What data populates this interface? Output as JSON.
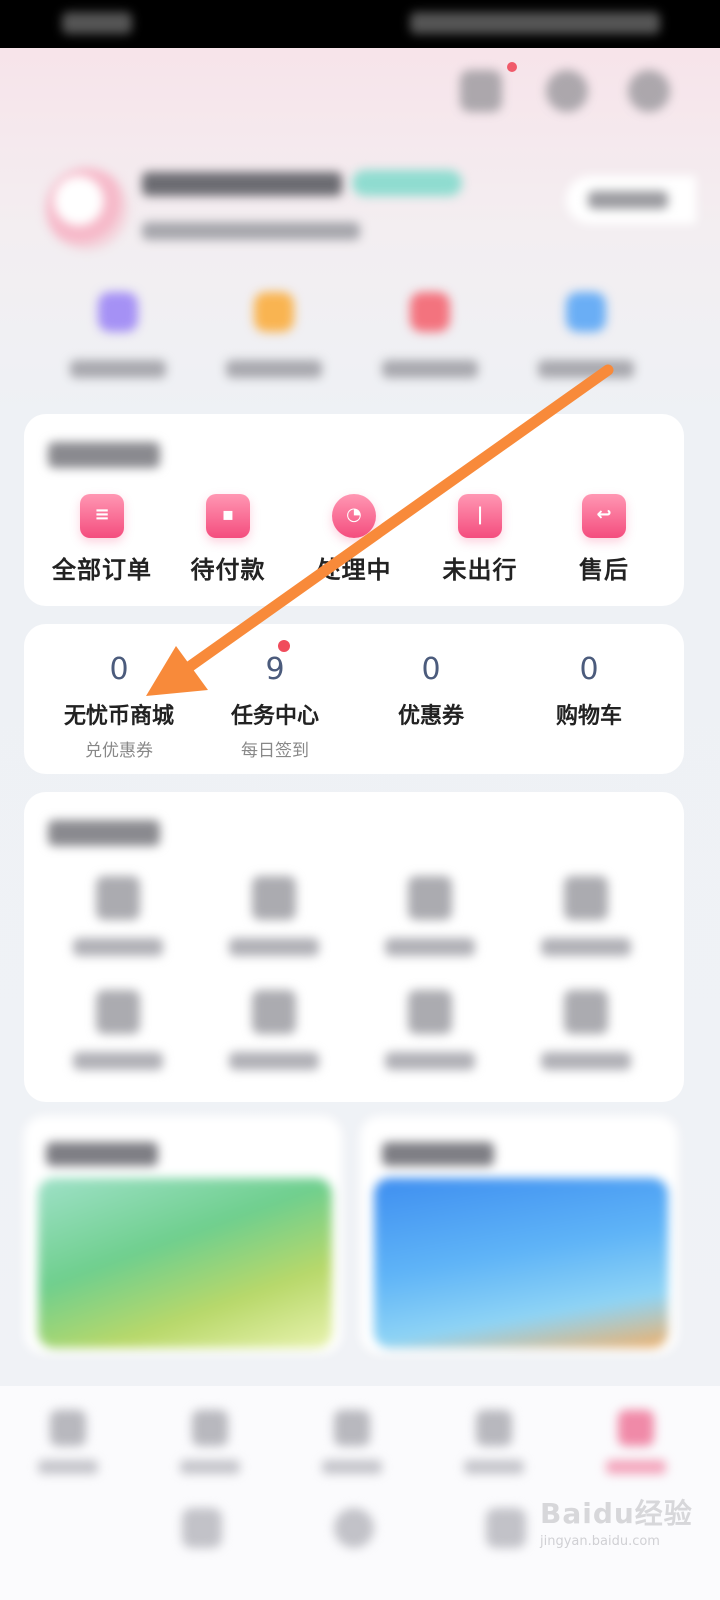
{
  "orders": {
    "items": [
      {
        "label": "全部订单",
        "icon": "order-list-icon"
      },
      {
        "label": "待付款",
        "icon": "wallet-icon"
      },
      {
        "label": "处理中",
        "icon": "clock-icon"
      },
      {
        "label": "未出行",
        "icon": "door-icon"
      },
      {
        "label": "售后",
        "icon": "return-icon"
      }
    ]
  },
  "stats": {
    "items": [
      {
        "value": "0",
        "label": "无忧币商城",
        "sub": "兑优惠券"
      },
      {
        "value": "9",
        "label": "任务中心",
        "sub": "每日签到"
      },
      {
        "value": "0",
        "label": "优惠券",
        "sub": ""
      },
      {
        "value": "0",
        "label": "购物车",
        "sub": ""
      }
    ]
  },
  "colors": {
    "accent": "#f44d7e",
    "stat_number": "#4b5b7c",
    "annotation_arrow": "#f88a3a",
    "badge_dot": "#f04c5c"
  },
  "watermark": {
    "text": "Baidu经验",
    "url_text": "jingyan.baidu.com"
  }
}
